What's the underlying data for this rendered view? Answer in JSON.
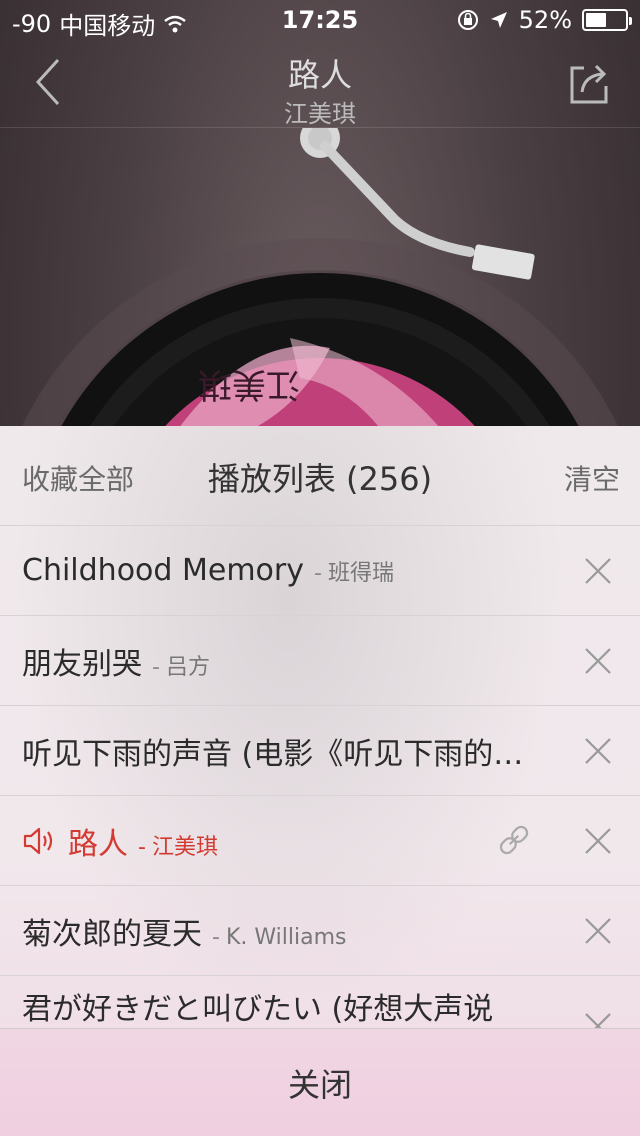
{
  "status_bar": {
    "signal": "-90",
    "carrier": "中国移动",
    "time": "17:25",
    "battery": "52%",
    "battery_level": 0.52
  },
  "nav": {
    "title": "路人",
    "subtitle": "江美琪"
  },
  "album_art": {
    "text": "江美琪"
  },
  "playlist": {
    "collect_all": "收藏全部",
    "title": "播放列表 (256)",
    "clear": "清空",
    "items": [
      {
        "song": "Childhood Memory",
        "artist": "班得瑞",
        "playing": false
      },
      {
        "song": "朋友别哭",
        "artist": "吕方",
        "playing": false
      },
      {
        "song": "听见下雨的声音 (电影《听见下雨的…",
        "artist": "",
        "playing": false
      },
      {
        "song": "路人",
        "artist": "江美琪",
        "playing": true
      },
      {
        "song": "菊次郎的夏天",
        "artist": "K. Williams",
        "playing": false
      },
      {
        "song": "君が好きだと叫びたい (好想大声说",
        "artist": "",
        "playing": false
      }
    ],
    "close": "关闭"
  },
  "colors": {
    "accent": "#d33a31",
    "sheet_bg": "#efe9eb",
    "divider": "#d9d2d5"
  }
}
